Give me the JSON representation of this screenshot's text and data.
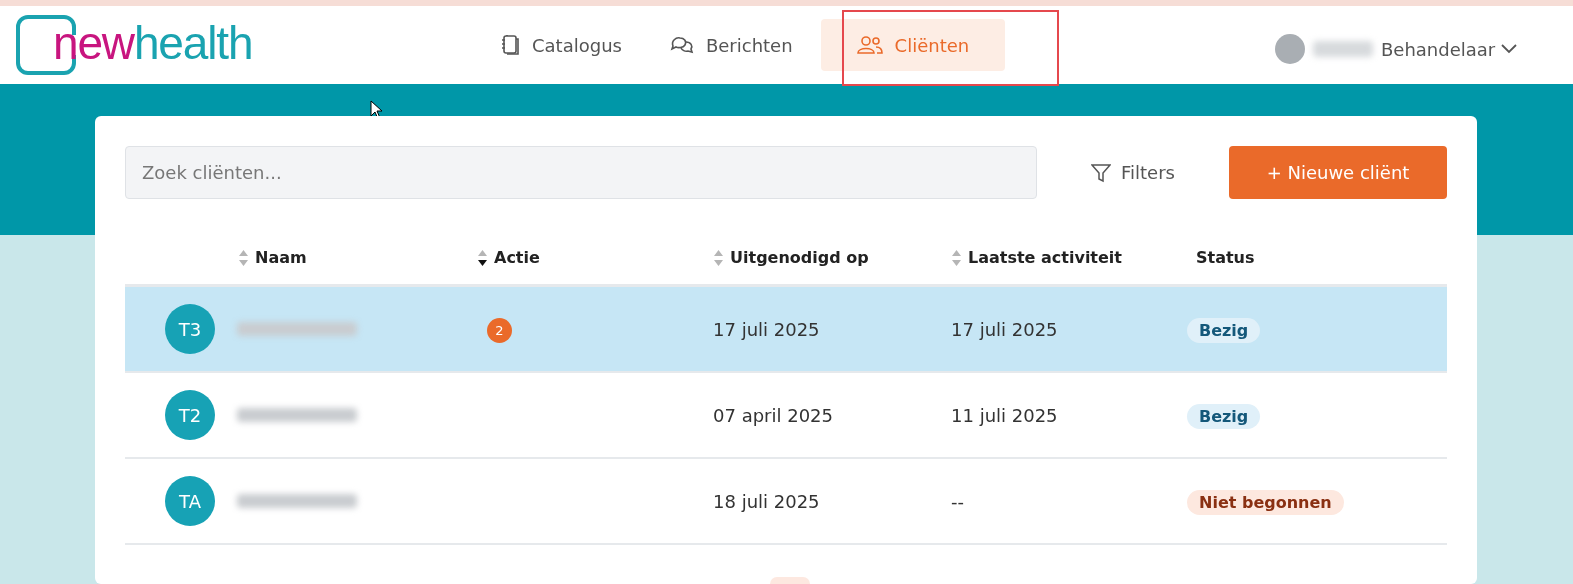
{
  "logo": {
    "part_1": "new",
    "part_2": "health"
  },
  "nav": [
    {
      "label": "Catalogus",
      "selected": false
    },
    {
      "label": "Berichten",
      "selected": false
    },
    {
      "label": "Cliënten",
      "selected": true
    }
  ],
  "user": {
    "role": "Behandelaar"
  },
  "search": {
    "placeholder": "Zoek cliënten..."
  },
  "filters_button": "Filters",
  "new_button": "+ Nieuwe cliënt",
  "table": {
    "columns": [
      {
        "label": "Naam",
        "kind": "sortable"
      },
      {
        "label": "Actie",
        "kind": "descending"
      },
      {
        "label": "Uitgenodigd op",
        "kind": "sortable"
      },
      {
        "label": "Laatste activiteit",
        "kind": "sortable"
      },
      {
        "label": "Status",
        "kind": "plain"
      }
    ],
    "rows": [
      {
        "initials": "T3",
        "actions": "2",
        "invited": "17 juli 2025",
        "last_activity": "17 juli 2025",
        "status": "Bezig",
        "kind": "progress",
        "selected": true
      },
      {
        "initials": "T2",
        "invited": "07 april 2025",
        "last_activity": "11 juli 2025",
        "status": "Bezig",
        "kind": "progress",
        "selected": false
      },
      {
        "initials": "TA",
        "invited": "18 juli 2025",
        "last_activity": "--",
        "status": "Niet begonnen",
        "kind": "unstarted",
        "selected": false
      }
    ]
  }
}
